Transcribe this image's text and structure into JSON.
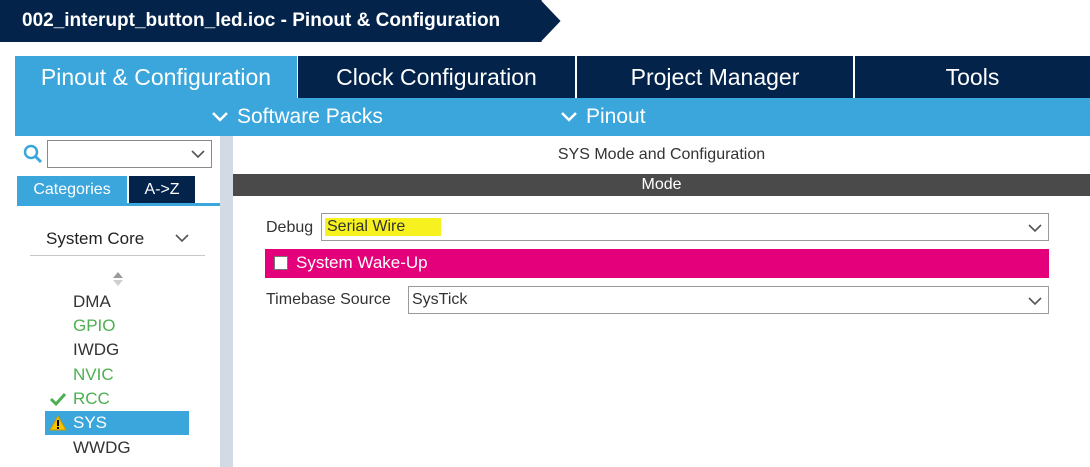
{
  "window": {
    "title": "002_interupt_button_led.ioc - Pinout & Configuration"
  },
  "colors": {
    "navy": "#03234b",
    "accent": "#3aa6dc",
    "wake_magenta": "#e4007b",
    "highlight_yellow": "#f7f21f",
    "ok_green": "#4caf50",
    "warn_yellow": "#f5c400"
  },
  "tabs": [
    {
      "label": "Pinout & Configuration",
      "active": true
    },
    {
      "label": "Clock Configuration",
      "active": false
    },
    {
      "label": "Project Manager",
      "active": false
    },
    {
      "label": "Tools",
      "active": false
    }
  ],
  "submenu": {
    "software_packs": "Software Packs",
    "pinout": "Pinout"
  },
  "sidebar": {
    "search_value": "",
    "search_icon": "search-icon",
    "tab_categories": "Categories",
    "tab_az": "A->Z",
    "group": "System Core",
    "items": [
      {
        "label": "DMA",
        "state": "normal",
        "color": "#333333"
      },
      {
        "label": "GPIO",
        "state": "configured",
        "color": "#4caf50"
      },
      {
        "label": "IWDG",
        "state": "normal",
        "color": "#333333"
      },
      {
        "label": "NVIC",
        "state": "configured",
        "color": "#4caf50"
      },
      {
        "label": "RCC",
        "state": "ok",
        "color": "#4caf50",
        "icon": "check-icon"
      },
      {
        "label": "SYS",
        "state": "warning-selected",
        "color": "#ffffff",
        "icon": "warning-icon"
      },
      {
        "label": "WWDG",
        "state": "normal",
        "color": "#333333"
      }
    ]
  },
  "main": {
    "title": "SYS Mode and Configuration",
    "section": "Mode",
    "debug": {
      "label": "Debug",
      "value": "Serial Wire"
    },
    "wakeup": {
      "label": "System Wake-Up",
      "checked": false
    },
    "timebase": {
      "label": "Timebase Source",
      "value": "SysTick"
    }
  }
}
